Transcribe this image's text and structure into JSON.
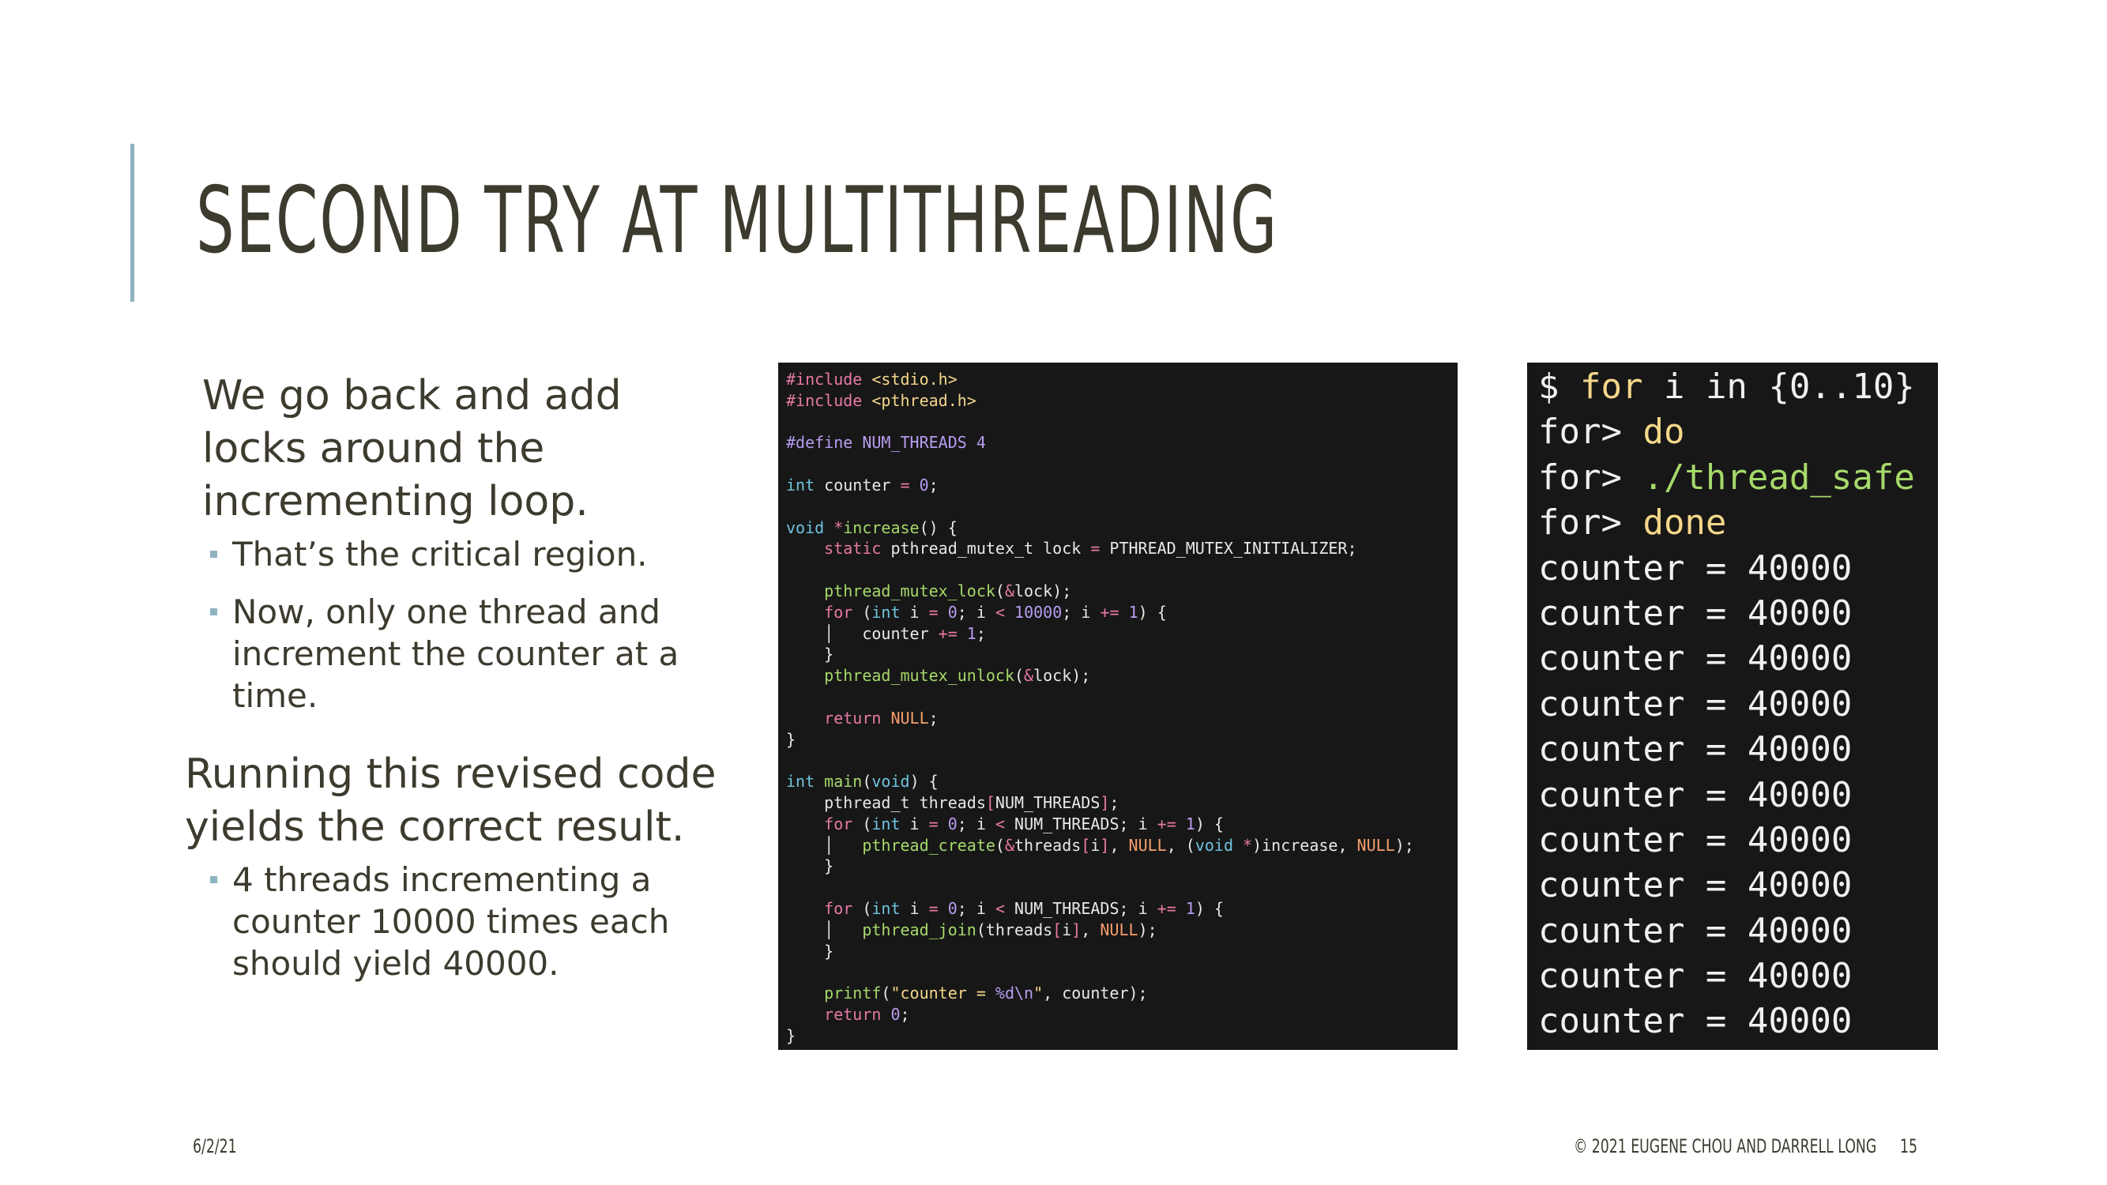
{
  "slide": {
    "title": "SECOND TRY AT MULTITHREADING",
    "paragraph1": "We go back and add locks around the incrementing loop.",
    "bullets1": [
      "That’s the critical region.",
      "Now, only one thread and increment the counter at a time."
    ],
    "paragraph2": "Running this revised code yields the correct result.",
    "bullets2": [
      "4 threads incrementing a counter 10000 times each should yield 40000."
    ]
  },
  "code": {
    "lines": [
      [
        [
          "#include ",
          "#e879a6"
        ],
        [
          "<stdio.h>",
          "#f4d78a"
        ]
      ],
      [
        [
          "#include ",
          "#e879a6"
        ],
        [
          "<pthread.h>",
          "#f4d78a"
        ]
      ],
      [],
      [
        [
          "#define NUM_THREADS 4",
          "#b89cf0"
        ]
      ],
      [],
      [
        [
          "int",
          "#6fc3df"
        ],
        [
          " counter ",
          "#e8e8e8"
        ],
        [
          "=",
          "#e879a6"
        ],
        [
          " ",
          "#e8e8e8"
        ],
        [
          "0",
          "#b89cf0"
        ],
        [
          ";",
          "#e8e8e8"
        ]
      ],
      [],
      [
        [
          "void",
          "#6fc3df"
        ],
        [
          " ",
          "#e8e8e8"
        ],
        [
          "*",
          "#e879a6"
        ],
        [
          "increase",
          "#a6d96a"
        ],
        [
          "() {",
          "#e8e8e8"
        ]
      ],
      [
        [
          "    ",
          "#e8e8e8"
        ],
        [
          "static",
          "#e879a6"
        ],
        [
          " pthread_mutex_t lock ",
          "#e8e8e8"
        ],
        [
          "=",
          "#e879a6"
        ],
        [
          " PTHREAD_MUTEX_INITIALIZER;",
          "#e8e8e8"
        ]
      ],
      [],
      [
        [
          "    ",
          "#e8e8e8"
        ],
        [
          "pthread_mutex_lock",
          "#a6d96a"
        ],
        [
          "(",
          "#e8e8e8"
        ],
        [
          "&",
          "#e879a6"
        ],
        [
          "lock);",
          "#e8e8e8"
        ]
      ],
      [
        [
          "    ",
          "#e8e8e8"
        ],
        [
          "for",
          "#e879a6"
        ],
        [
          " (",
          "#e8e8e8"
        ],
        [
          "int",
          "#6fc3df"
        ],
        [
          " i ",
          "#e8e8e8"
        ],
        [
          "=",
          "#e879a6"
        ],
        [
          " ",
          "#e8e8e8"
        ],
        [
          "0",
          "#b89cf0"
        ],
        [
          "; i ",
          "#e8e8e8"
        ],
        [
          "<",
          "#e879a6"
        ],
        [
          " ",
          "#e8e8e8"
        ],
        [
          "10000",
          "#b89cf0"
        ],
        [
          "; i ",
          "#e8e8e8"
        ],
        [
          "+=",
          "#e879a6"
        ],
        [
          " ",
          "#e8e8e8"
        ],
        [
          "1",
          "#b89cf0"
        ],
        [
          ") {",
          "#e8e8e8"
        ]
      ],
      [
        [
          "    │   counter ",
          "#e8e8e8"
        ],
        [
          "+=",
          "#e879a6"
        ],
        [
          " ",
          "#e8e8e8"
        ],
        [
          "1",
          "#b89cf0"
        ],
        [
          ";",
          "#e8e8e8"
        ]
      ],
      [
        [
          "    }",
          "#e8e8e8"
        ]
      ],
      [
        [
          "    ",
          "#e8e8e8"
        ],
        [
          "pthread_mutex_unlock",
          "#a6d96a"
        ],
        [
          "(",
          "#e8e8e8"
        ],
        [
          "&",
          "#e879a6"
        ],
        [
          "lock);",
          "#e8e8e8"
        ]
      ],
      [],
      [
        [
          "    ",
          "#e8e8e8"
        ],
        [
          "return",
          "#e879a6"
        ],
        [
          " ",
          "#e8e8e8"
        ],
        [
          "NULL",
          "#f59e6c"
        ],
        [
          ";",
          "#e8e8e8"
        ]
      ],
      [
        [
          "}",
          "#e8e8e8"
        ]
      ],
      [],
      [
        [
          "int",
          "#6fc3df"
        ],
        [
          " ",
          "#e8e8e8"
        ],
        [
          "main",
          "#a6d96a"
        ],
        [
          "(",
          "#e8e8e8"
        ],
        [
          "void",
          "#6fc3df"
        ],
        [
          ") {",
          "#e8e8e8"
        ]
      ],
      [
        [
          "    pthread_t threads",
          "#e8e8e8"
        ],
        [
          "[",
          "#e879a6"
        ],
        [
          "NUM_THREADS",
          "#e8e8e8"
        ],
        [
          "]",
          "#e879a6"
        ],
        [
          ";",
          "#e8e8e8"
        ]
      ],
      [
        [
          "    ",
          "#e8e8e8"
        ],
        [
          "for",
          "#e879a6"
        ],
        [
          " (",
          "#e8e8e8"
        ],
        [
          "int",
          "#6fc3df"
        ],
        [
          " i ",
          "#e8e8e8"
        ],
        [
          "=",
          "#e879a6"
        ],
        [
          " ",
          "#e8e8e8"
        ],
        [
          "0",
          "#b89cf0"
        ],
        [
          "; i ",
          "#e8e8e8"
        ],
        [
          "<",
          "#e879a6"
        ],
        [
          " NUM_THREADS; i ",
          "#e8e8e8"
        ],
        [
          "+=",
          "#e879a6"
        ],
        [
          " ",
          "#e8e8e8"
        ],
        [
          "1",
          "#b89cf0"
        ],
        [
          ") {",
          "#e8e8e8"
        ]
      ],
      [
        [
          "    │   ",
          "#e8e8e8"
        ],
        [
          "pthread_create",
          "#a6d96a"
        ],
        [
          "(",
          "#e8e8e8"
        ],
        [
          "&",
          "#e879a6"
        ],
        [
          "threads",
          "#e8e8e8"
        ],
        [
          "[",
          "#e879a6"
        ],
        [
          "i",
          "#e8e8e8"
        ],
        [
          "]",
          "#e879a6"
        ],
        [
          ", ",
          "#e8e8e8"
        ],
        [
          "NULL",
          "#f59e6c"
        ],
        [
          ", (",
          "#e8e8e8"
        ],
        [
          "void",
          "#6fc3df"
        ],
        [
          " ",
          "#e8e8e8"
        ],
        [
          "*",
          "#e879a6"
        ],
        [
          ")increase, ",
          "#e8e8e8"
        ],
        [
          "NULL",
          "#f59e6c"
        ],
        [
          ");",
          "#e8e8e8"
        ]
      ],
      [
        [
          "    }",
          "#e8e8e8"
        ]
      ],
      [],
      [
        [
          "    ",
          "#e8e8e8"
        ],
        [
          "for",
          "#e879a6"
        ],
        [
          " (",
          "#e8e8e8"
        ],
        [
          "int",
          "#6fc3df"
        ],
        [
          " i ",
          "#e8e8e8"
        ],
        [
          "=",
          "#e879a6"
        ],
        [
          " ",
          "#e8e8e8"
        ],
        [
          "0",
          "#b89cf0"
        ],
        [
          "; i ",
          "#e8e8e8"
        ],
        [
          "<",
          "#e879a6"
        ],
        [
          " NUM_THREADS; i ",
          "#e8e8e8"
        ],
        [
          "+=",
          "#e879a6"
        ],
        [
          " ",
          "#e8e8e8"
        ],
        [
          "1",
          "#b89cf0"
        ],
        [
          ") {",
          "#e8e8e8"
        ]
      ],
      [
        [
          "    │   ",
          "#e8e8e8"
        ],
        [
          "pthread_join",
          "#a6d96a"
        ],
        [
          "(threads",
          "#e8e8e8"
        ],
        [
          "[",
          "#e879a6"
        ],
        [
          "i",
          "#e8e8e8"
        ],
        [
          "]",
          "#e879a6"
        ],
        [
          ", ",
          "#e8e8e8"
        ],
        [
          "NULL",
          "#f59e6c"
        ],
        [
          ");",
          "#e8e8e8"
        ]
      ],
      [
        [
          "    }",
          "#e8e8e8"
        ]
      ],
      [],
      [
        [
          "    ",
          "#e8e8e8"
        ],
        [
          "printf",
          "#a6d96a"
        ],
        [
          "(",
          "#e8e8e8"
        ],
        [
          "\"counter = ",
          "#f4d78a"
        ],
        [
          "%d\\n",
          "#b89cf0"
        ],
        [
          "\"",
          "#f4d78a"
        ],
        [
          ", counter);",
          "#e8e8e8"
        ]
      ],
      [
        [
          "    ",
          "#e8e8e8"
        ],
        [
          "return",
          "#e879a6"
        ],
        [
          " ",
          "#e8e8e8"
        ],
        [
          "0",
          "#b89cf0"
        ],
        [
          ";",
          "#e8e8e8"
        ]
      ],
      [
        [
          "}",
          "#e8e8e8"
        ]
      ]
    ]
  },
  "terminal": {
    "lines": [
      [
        [
          "$ ",
          "#f0f0f0"
        ],
        [
          "for",
          "#f4d78a"
        ],
        [
          " i in {0..10}",
          "#f0f0f0"
        ]
      ],
      [
        [
          "for> ",
          "#f0f0f0"
        ],
        [
          "do",
          "#f4d78a"
        ]
      ],
      [
        [
          "for> ",
          "#f0f0f0"
        ],
        [
          "./thread_safe",
          "#a6d96a"
        ]
      ],
      [
        [
          "for> ",
          "#f0f0f0"
        ],
        [
          "done",
          "#f4d78a"
        ]
      ],
      [
        [
          "counter = 40000",
          "#f0f0f0"
        ]
      ],
      [
        [
          "counter = 40000",
          "#f0f0f0"
        ]
      ],
      [
        [
          "counter = 40000",
          "#f0f0f0"
        ]
      ],
      [
        [
          "counter = 40000",
          "#f0f0f0"
        ]
      ],
      [
        [
          "counter = 40000",
          "#f0f0f0"
        ]
      ],
      [
        [
          "counter = 40000",
          "#f0f0f0"
        ]
      ],
      [
        [
          "counter = 40000",
          "#f0f0f0"
        ]
      ],
      [
        [
          "counter = 40000",
          "#f0f0f0"
        ]
      ],
      [
        [
          "counter = 40000",
          "#f0f0f0"
        ]
      ],
      [
        [
          "counter = 40000",
          "#f0f0f0"
        ]
      ],
      [
        [
          "counter = 40000",
          "#f0f0f0"
        ]
      ]
    ]
  },
  "footer": {
    "date": "6/2/21",
    "copyright": "© 2021 EUGENE CHOU AND DARRELL LONG",
    "page_number": "15"
  }
}
